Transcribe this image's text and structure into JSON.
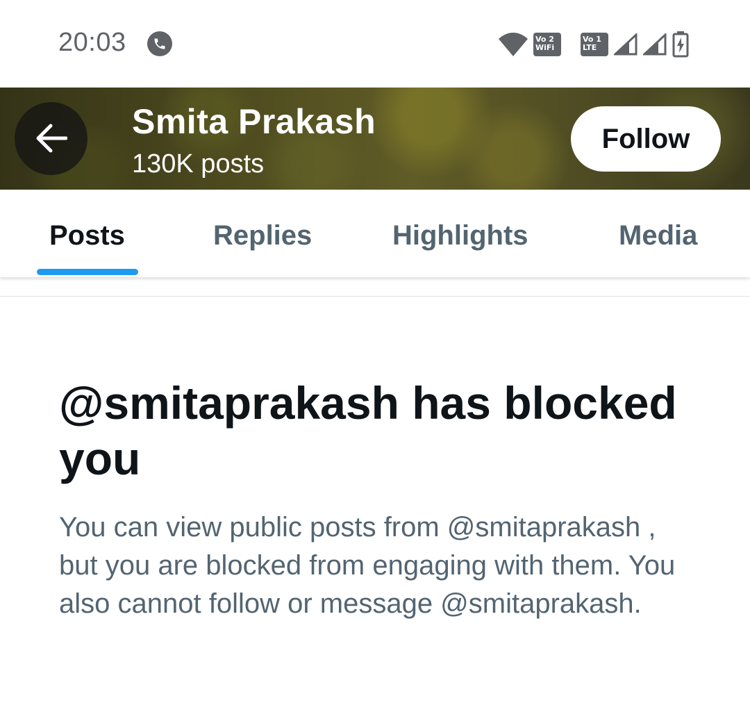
{
  "status_bar": {
    "time": "20:03",
    "volte1": [
      "Vo 2",
      "WiFi"
    ],
    "volte2": [
      "Vo 1",
      "LTE"
    ]
  },
  "header": {
    "name": "Smita Prakash",
    "posts_count": "130K posts",
    "follow_label": "Follow"
  },
  "tabs": [
    {
      "label": "Posts",
      "active": true
    },
    {
      "label": "Replies",
      "active": false
    },
    {
      "label": "Highlights",
      "active": false
    },
    {
      "label": "Media",
      "active": false
    }
  ],
  "block_message": {
    "title": "@smitaprakash has blocked you",
    "description": "You can view public posts from @smitaprakash , but you are blocked from engaging with them. You also cannot follow or message @smitaprakash."
  },
  "colors": {
    "accent": "#1d9bf0",
    "text_primary": "#0f1419",
    "text_secondary": "#536471"
  },
  "icons": [
    "phone-call-icon",
    "wifi-icon",
    "signal-icon",
    "battery-charging-icon",
    "back-arrow-icon"
  ]
}
